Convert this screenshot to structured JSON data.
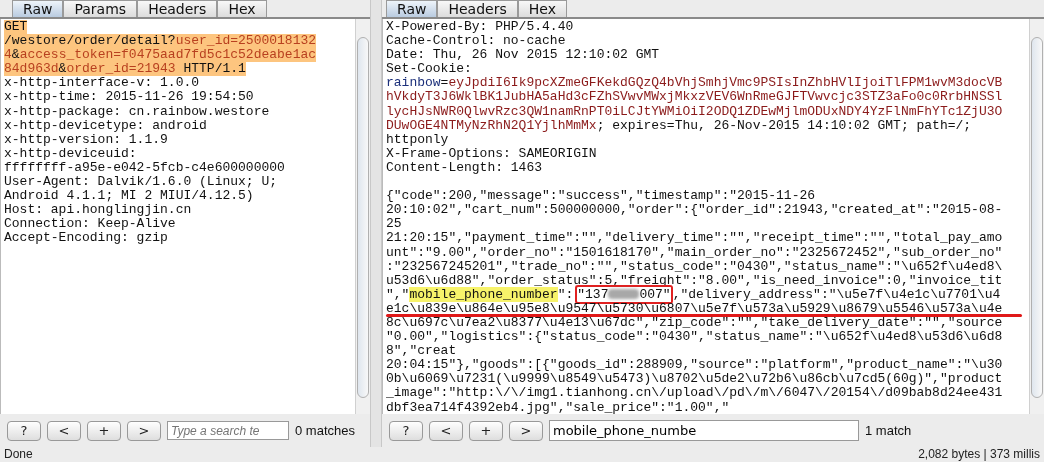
{
  "request": {
    "tabs": [
      {
        "label": "Raw",
        "selected": true
      },
      {
        "label": "Params",
        "selected": false
      },
      {
        "label": "Headers",
        "selected": false
      },
      {
        "label": "Hex",
        "selected": false
      }
    ],
    "lines": [
      {
        "selected": true,
        "segments": [
          {
            "text": "GET",
            "kind": "plain"
          }
        ]
      },
      {
        "selected": true,
        "segments": [
          {
            "text": "/westore/order/detail?",
            "kind": "plain"
          },
          {
            "text": "user_id=2500018132",
            "kind": "param"
          }
        ]
      },
      {
        "selected": true,
        "segments": [
          {
            "text": "4",
            "kind": "param"
          },
          {
            "text": "&",
            "kind": "plain"
          },
          {
            "text": "access_token=f0475aad7fd5c1c52deabe1ac",
            "kind": "param"
          }
        ]
      },
      {
        "selected": true,
        "segments": [
          {
            "text": "84d963d",
            "kind": "param"
          },
          {
            "text": "&",
            "kind": "plain"
          },
          {
            "text": "order_id=21943",
            "kind": "param"
          },
          {
            "text": " HTTP/1.1",
            "kind": "plain"
          }
        ]
      },
      {
        "selected": false,
        "segments": [
          {
            "text": "x-http-interface-v: 1.0.0",
            "kind": "plain"
          }
        ]
      },
      {
        "selected": false,
        "segments": [
          {
            "text": "x-http-time: 2015-11-26 19:54:50",
            "kind": "plain"
          }
        ]
      },
      {
        "selected": false,
        "segments": [
          {
            "text": "x-http-package: cn.rainbow.westore",
            "kind": "plain"
          }
        ]
      },
      {
        "selected": false,
        "segments": [
          {
            "text": "x-http-devicetype: android",
            "kind": "plain"
          }
        ]
      },
      {
        "selected": false,
        "segments": [
          {
            "text": "x-http-version: 1.1.9",
            "kind": "plain"
          }
        ]
      },
      {
        "selected": false,
        "segments": [
          {
            "text": "x-http-deviceuid:",
            "kind": "plain"
          }
        ]
      },
      {
        "selected": false,
        "segments": [
          {
            "text": "ffffffff-a95e-e042-5fcb-c4e600000000",
            "kind": "plain"
          }
        ]
      },
      {
        "selected": false,
        "segments": [
          {
            "text": "User-Agent: Dalvik/1.6.0 (Linux; U;",
            "kind": "plain"
          }
        ]
      },
      {
        "selected": false,
        "segments": [
          {
            "text": "Android 4.1.1; MI 2 MIUI/4.12.5)",
            "kind": "plain"
          }
        ]
      },
      {
        "selected": false,
        "segments": [
          {
            "text": "Host: api.honglingjin.cn",
            "kind": "plain"
          }
        ]
      },
      {
        "selected": false,
        "segments": [
          {
            "text": "Connection: Keep-Alive",
            "kind": "plain"
          }
        ]
      },
      {
        "selected": false,
        "segments": [
          {
            "text": "Accept-Encoding: gzip",
            "kind": "plain"
          }
        ]
      }
    ],
    "toolbar": {
      "buttons": [
        "?",
        "<",
        "+",
        ">"
      ],
      "search": {
        "placeholder": "Type a search te"
      },
      "matches": "0 matches"
    }
  },
  "response": {
    "tabs": [
      {
        "label": "Raw",
        "selected": true
      },
      {
        "label": "Headers",
        "selected": false
      },
      {
        "label": "Hex",
        "selected": false
      }
    ],
    "header_lines": [
      {
        "underlined": false,
        "segments": [
          {
            "text": "X-Powered-By: PHP/5.4.40",
            "kind": "plain"
          }
        ]
      },
      {
        "underlined": false,
        "segments": [
          {
            "text": "Cache-Control: no-cache",
            "kind": "plain"
          }
        ]
      },
      {
        "underlined": false,
        "segments": [
          {
            "text": "Date: Thu, 26 Nov 2015 12:10:02 GMT",
            "kind": "plain"
          }
        ]
      },
      {
        "underlined": false,
        "segments": [
          {
            "text": "Set-Cookie:",
            "kind": "plain"
          }
        ]
      },
      {
        "underlined": false,
        "segments": [
          {
            "text": "rainbow",
            "kind": "cookie-name"
          },
          {
            "text": "=",
            "kind": "plain"
          },
          {
            "text": "eyJpdiI6Ik9pcXZmeGFKekdGQzQ4bVhjSmhjVmc9PSIsInZhbHVlIjoiTlFPM1wvM3docVB",
            "kind": "cookie-value"
          }
        ]
      },
      {
        "underlined": false,
        "segments": [
          {
            "text": "hVkdyT3J6WklBK1JubHA5aHd3cFZhSVwvMWxjMkxzVEV6WnRmeGJFTVwvcjc3STZ3aFo0c0RrbHNSSl",
            "kind": "cookie-value"
          }
        ]
      },
      {
        "underlined": false,
        "segments": [
          {
            "text": "lycHJsNWR0QlwvRzc3QW1namRnPT0iLCJtYWMiOiI2ODQ1ZDEwMjlmODUxNDY4YzFlNmFhYTc1ZjU3O",
            "kind": "cookie-value"
          }
        ]
      },
      {
        "underlined": false,
        "segments": [
          {
            "text": "DUwOGE4NTMyNzRhN2Q1YjlhMmMx",
            "kind": "cookie-value"
          },
          {
            "text": "; expires=Thu, 26-Nov-2015 14:10:02 GMT; path=/;",
            "kind": "plain"
          }
        ]
      },
      {
        "underlined": false,
        "segments": [
          {
            "text": "httponly",
            "kind": "plain"
          }
        ]
      },
      {
        "underlined": false,
        "segments": [
          {
            "text": "X-Frame-Options: SAMEORIGIN",
            "kind": "plain"
          }
        ]
      },
      {
        "underlined": false,
        "segments": [
          {
            "text": "Content-Length: 1463",
            "kind": "plain"
          }
        ]
      }
    ],
    "body_lines": [
      {
        "underlined": false,
        "segments": [
          {
            "text": "{\"code\":200,\"message\":\"success\",\"timestamp\":\"2015-11-26",
            "kind": "plain"
          }
        ]
      },
      {
        "underlined": false,
        "segments": [
          {
            "text": "20:10:02\",\"cart_num\":500000000,\"order\":{\"order_id\":21943,\"created_at\":\"2015-08-",
            "kind": "plain"
          }
        ]
      },
      {
        "underlined": false,
        "segments": [
          {
            "text": "25",
            "kind": "plain"
          }
        ]
      },
      {
        "underlined": false,
        "segments": [
          {
            "text": "21:20:15\",\"payment_time\":\"\",\"delivery_time\":\"\",\"receipt_time\":\"\",\"total_pay_amo",
            "kind": "plain"
          }
        ]
      },
      {
        "underlined": false,
        "segments": [
          {
            "text": "unt\":\"9.00\",\"order_no\":\"1501618170\",\"main_order_no\":\"2325672452\",\"sub_order_no\"",
            "kind": "plain"
          }
        ]
      },
      {
        "underlined": false,
        "segments": [
          {
            "text": ":\"232567245201\",\"trade_no\":\"\",\"status_code\":\"0430\",\"status_name\":\"\\u652f\\u4ed8\\",
            "kind": "plain"
          }
        ]
      },
      {
        "underlined": false,
        "segments": [
          {
            "text": "u53d6\\u6d88\",\"order_status\":5,\"freight\":\"8.00\",\"is_need_invoice\":0,\"invoice_tit",
            "kind": "plain"
          }
        ]
      },
      {
        "underlined": false,
        "segments": [
          {
            "text": "\",\"",
            "kind": "plain"
          },
          {
            "text": "mobile_phone_number",
            "kind": "match"
          },
          {
            "text": "\":",
            "kind": "plain"
          },
          {
            "text": "\"137",
            "kind": "boxed-start"
          },
          {
            "text": "007\"",
            "kind": "boxed-end"
          },
          {
            "text": ",\"delivery_address\":\"\\u5e7f\\u4e1c\\u7701\\u4",
            "kind": "plain"
          }
        ]
      },
      {
        "underlined": true,
        "segments": [
          {
            "text": "e1c\\u839e\\u864e\\u95e8\\u9547\\u5730\\u6807\\u5e7f\\u573a\\u5929\\u8679\\u5546\\u573a\\u4e",
            "kind": "plain"
          }
        ]
      },
      {
        "underlined": false,
        "segments": [
          {
            "text": "8c\\u697c\\u7ea2\\u8377\\u4e13\\u67dc\",\"zip_code\":\"\",\"take_delivery_date\":\"\",\"source",
            "kind": "plain"
          }
        ]
      },
      {
        "underlined": false,
        "segments": [
          {
            "text": "\"0.00\",\"logistics\":{\"status_code\":\"0430\",\"status_name\":\"\\u652f\\u4ed8\\u53d6\\u6d8",
            "kind": "plain"
          }
        ]
      },
      {
        "underlined": false,
        "segments": [
          {
            "text": "8\",\"creat",
            "kind": "plain"
          }
        ]
      },
      {
        "underlined": false,
        "segments": [
          {
            "text": "20:04:15\"},\"goods\":[{\"goods_id\":288909,\"source\":\"platform\",\"product_name\":\"\\u30",
            "kind": "plain"
          }
        ]
      },
      {
        "underlined": false,
        "segments": [
          {
            "text": "0b\\u6069\\u7231(\\u9999\\u8549\\u5473)\\u8702\\u5de2\\u72b6\\u86cb\\u7cd5(60g)\",\"product",
            "kind": "plain"
          }
        ]
      },
      {
        "underlined": false,
        "segments": [
          {
            "text": "_image\":\"http:\\/\\/img1.tianhong.cn\\/upload\\/pd\\/m\\/6047\\/20154\\/d09bab8d24ee431",
            "kind": "plain"
          }
        ]
      },
      {
        "underlined": false,
        "segments": [
          {
            "text": "dbf3ea714f4392eb4.jpg\",\"sale_price\":\"1.00\",\"",
            "kind": "plain"
          }
        ]
      }
    ],
    "toolbar": {
      "buttons": [
        "?",
        "<",
        "+",
        ">"
      ],
      "search": {
        "value": "mobile_phone_numbe"
      },
      "matches": "1 match"
    }
  },
  "status_bar": {
    "left": "Done",
    "right": "2,082 bytes | 373 millis"
  }
}
